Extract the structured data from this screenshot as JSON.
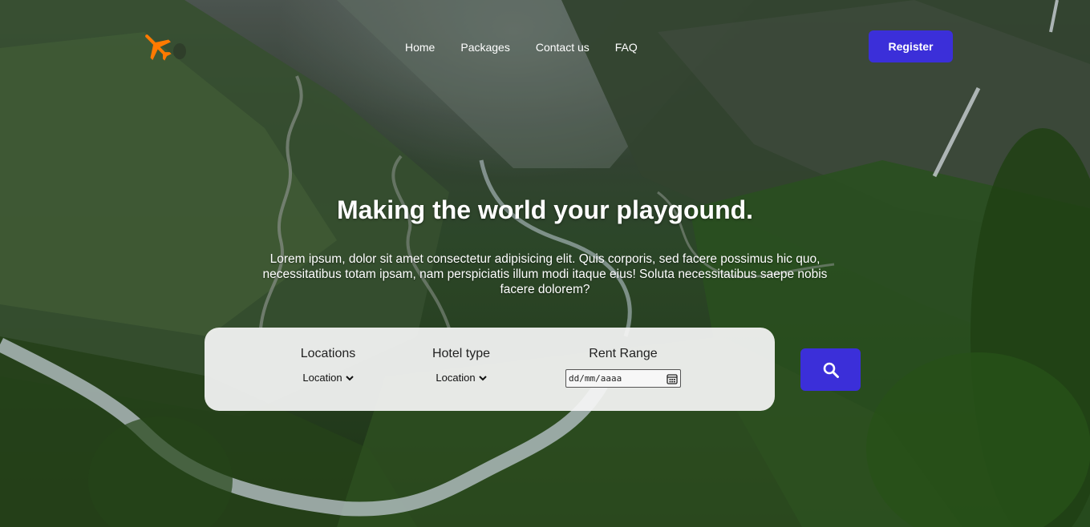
{
  "nav": {
    "items": [
      {
        "label": "Home"
      },
      {
        "label": "Packages"
      },
      {
        "label": "Contact us"
      },
      {
        "label": "FAQ"
      }
    ],
    "register_label": "Register"
  },
  "hero": {
    "title": "Making the world your playgound.",
    "text": "Lorem ipsum, dolor sit amet consectetur adipisicing elit. Quis corporis, sed facere possimus hic quo, necessitatibus totam ipsam, nam perspiciatis illum modi itaque eius! Soluta necessitatibus saepe nobis facere dolorem?"
  },
  "search": {
    "locations": {
      "label": "Locations",
      "value": "Location"
    },
    "hotel_type": {
      "label": "Hotel type",
      "value": "Location"
    },
    "rent_range": {
      "label": "Rent Range",
      "date_placeholder": "dd/mm/aaaa"
    }
  },
  "colors": {
    "accent": "#3b2fd9",
    "logo": "#ff7a00"
  },
  "icons": {
    "logo": "airplane-icon",
    "search": "search-icon",
    "chevron": "chevron-down-icon",
    "calendar": "calendar-icon"
  }
}
